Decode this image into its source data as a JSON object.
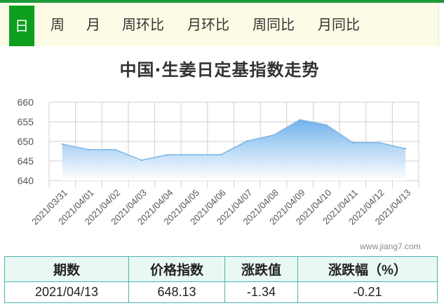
{
  "tabs": [
    {
      "label": "日",
      "active": true
    },
    {
      "label": "周",
      "active": false
    },
    {
      "label": "月",
      "active": false
    },
    {
      "label": "周环比",
      "active": false
    },
    {
      "label": "月环比",
      "active": false
    },
    {
      "label": "周同比",
      "active": false
    },
    {
      "label": "月同比",
      "active": false
    }
  ],
  "colors": {
    "accent": "#0d9e1d",
    "tab_bg": "#fcfbe5",
    "area_top": "#6aaeea",
    "area_bottom": "#ffffff",
    "line": "#7ab5e6",
    "table_border": "#4db3ad",
    "table_header_bg": "#e9f8f3"
  },
  "chart_data": {
    "type": "area",
    "title": "中国·生姜日定基指数走势",
    "categories": [
      "2021/03/31",
      "2021/04/01",
      "2021/04/02",
      "2021/04/03",
      "2021/04/04",
      "2021/04/05",
      "2021/04/06",
      "2021/04/07",
      "2021/04/08",
      "2021/04/09",
      "2021/04/10",
      "2021/04/11",
      "2021/04/12",
      "2021/04/13"
    ],
    "series": [
      {
        "values": [
          649.3,
          647.9,
          647.9,
          645.2,
          646.6,
          646.6,
          646.6,
          650.1,
          651.6,
          655.5,
          654.2,
          649.7,
          649.7,
          648.13
        ]
      }
    ],
    "ylim": [
      640,
      660
    ],
    "yticks": [
      640,
      645,
      650,
      655,
      660
    ],
    "grid": true,
    "xlabel": "",
    "ylabel": ""
  },
  "watermark": "www.jiang7.com",
  "summary_table": {
    "headers": [
      "期数",
      "价格指数",
      "涨跌值",
      "涨跌幅（%）"
    ],
    "row": [
      "2021/04/13",
      "648.13",
      "-1.34",
      "-0.21"
    ]
  }
}
